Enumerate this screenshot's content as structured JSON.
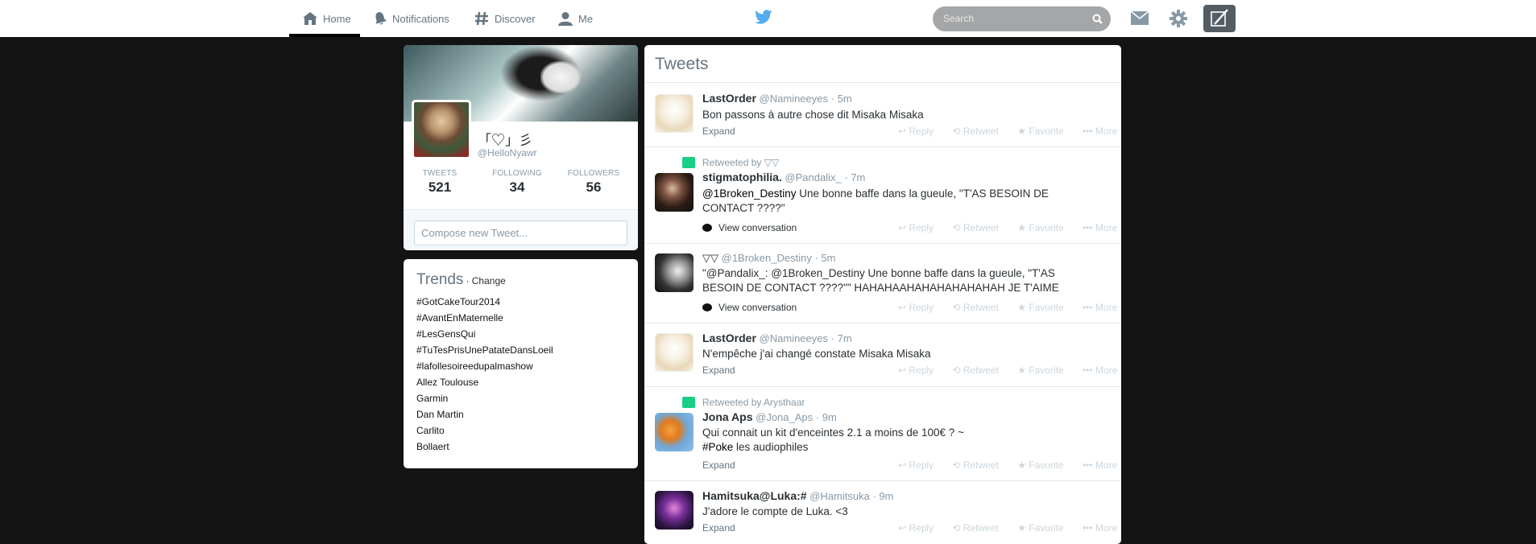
{
  "nav": {
    "home": "Home",
    "notifications": "Notifications",
    "discover": "Discover",
    "me": "Me",
    "search_placeholder": "Search"
  },
  "profile": {
    "name": "「♡」彡",
    "handle": "@HelloNyawr",
    "tweets_label": "TWEETS",
    "tweets": "521",
    "following_label": "FOLLOWING",
    "following": "34",
    "followers_label": "FOLLOWERS",
    "followers": "56",
    "compose_placeholder": "Compose new Tweet..."
  },
  "trends": {
    "title": "Trends",
    "change": "· Change",
    "items": [
      "#GotCakeTour2014",
      "#AvantEnMaternelle",
      "#LesGensQui",
      "#TuTesPrisUnePatateDansLoeil",
      "#lafollesoireedupalmashow",
      "Allez Toulouse",
      "Garmin",
      "Dan Martin",
      "Carlito",
      "Bollaert"
    ]
  },
  "stream": {
    "title": "Tweets",
    "actions": {
      "reply": "Reply",
      "retweet": "Retweet",
      "favorite": "Favorite",
      "more": "More"
    },
    "tweets": [
      {
        "name": "LastOrder",
        "handle": "@Namineeyes",
        "time": "5m",
        "text": "Bon passons à autre chose dit Misaka Misaka",
        "footer": "Expand"
      },
      {
        "context": "Retweeted by ▽▽",
        "name": "stigmatophilia.",
        "handle": "@Pandalix_",
        "time": "7m",
        "mention": "@1Broken_Destiny",
        "text": " Une bonne baffe dans la gueule, \"T'AS BESOIN DE CONTACT ????\"",
        "footer": "View conversation"
      },
      {
        "name": "▽▽",
        "handle": "@1Broken_Destiny",
        "time": "5m",
        "text": "\"@Pandalix_: @1Broken_Destiny Une bonne baffe dans la gueule, \"T'AS BESOIN DE CONTACT ????\"\" HAHAHAAHAHAHAHAHAHAH JE T'AIME",
        "footer": "View conversation"
      },
      {
        "name": "LastOrder",
        "handle": "@Namineeyes",
        "time": "7m",
        "text": "N'empêche j'ai changé constate Misaka Misaka",
        "footer": "Expand"
      },
      {
        "context": "Retweeted by Arysthaar",
        "name": "Jona Aps",
        "handle": "@Jona_Aps",
        "time": "9m",
        "text": "Qui connait un kit d'enceintes 2.1 a moins de 100€ ? ~",
        "hashtag": "#Poke",
        "text2": " les audiophiles",
        "footer": "Expand"
      },
      {
        "name": "Hamitsuka@Luka:#",
        "handle": "@Hamitsuka",
        "time": "9m",
        "text": "J'adore le compte de Luka. <3",
        "footer": "Expand"
      }
    ]
  }
}
